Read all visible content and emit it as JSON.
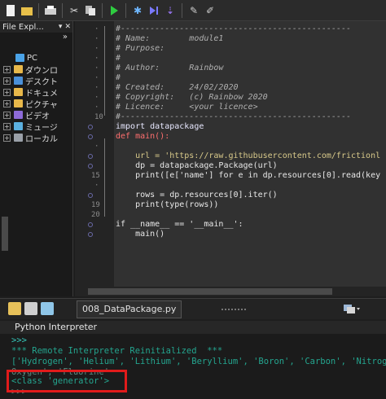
{
  "toolbar": {
    "buttons": [
      "new-file",
      "open",
      "print",
      "cut",
      "copy",
      "run",
      "debug",
      "step-into",
      "step-over",
      "comment",
      "uncomment"
    ]
  },
  "explorer": {
    "title": "File Expl...",
    "tree": [
      {
        "label": "PC",
        "icon": "pc-icon"
      },
      {
        "label": "ダウンロ",
        "icon": "folder-icon"
      },
      {
        "label": "デスクト",
        "icon": "folder-icon"
      },
      {
        "label": "ドキュメ",
        "icon": "folder-icon"
      },
      {
        "label": "ピクチャ",
        "icon": "folder-icon"
      },
      {
        "label": "ビデオ",
        "icon": "folder-icon"
      },
      {
        "label": "ミュージ",
        "icon": "folder-icon"
      },
      {
        "label": "ローカル",
        "icon": "drive-icon"
      }
    ]
  },
  "editor": {
    "line_numbers": {
      "ten": "10",
      "fifteen": "15",
      "nineteen": "19",
      "twenty": "20"
    },
    "lines": [
      "#-----------------------------------------------",
      "# Name:        module1",
      "# Purpose:",
      "#",
      "# Author:      Rainbow",
      "#",
      "# Created:     24/02/2020",
      "# Copyright:   (c) Rainbow 2020",
      "# Licence:     <your licence>",
      "#-----------------------------------------------",
      "import datapackage",
      "def main():",
      "",
      "    url = 'https://raw.githubusercontent.com/frictionl",
      "    dp = datapackage.Package(url)",
      "    print([e['name'] for e in dp.resources[0].read(key",
      "",
      "    rows = dp.resources[0].iter()",
      "    print(type(rows))",
      "",
      "if __name__ == '__main__':",
      "    main()"
    ]
  },
  "tabs": {
    "file_tab": "008_DataPackage.py"
  },
  "interpreter": {
    "title": "Python Interpreter",
    "lines": [
      ">>>",
      "*** Remote Interpreter Reinitialized  ***",
      "['Hydrogen', 'Helium', 'Lithium', 'Beryllium', 'Boron', 'Carbon', 'Nitrogen'",
      "Oxygen', 'Fluorine'",
      "<class 'generator'>",
      ">>>"
    ]
  },
  "colors": {
    "highlight_border": "#e01b1b",
    "interpreter_text": "#24a58f"
  }
}
